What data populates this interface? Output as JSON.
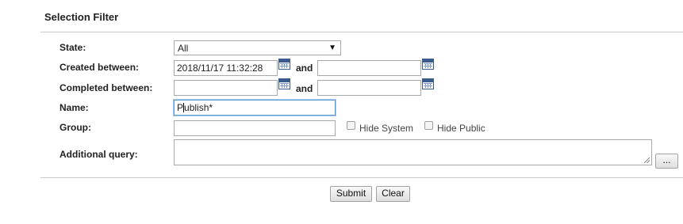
{
  "header": {
    "title": "Selection Filter"
  },
  "form": {
    "state": {
      "label": "State:",
      "value": "All"
    },
    "created": {
      "label": "Created between:",
      "from": "2018/11/17 11:32:28",
      "and": "and",
      "to": ""
    },
    "completed": {
      "label": "Completed between:",
      "from": "",
      "and": "and",
      "to": ""
    },
    "name": {
      "label": "Name:",
      "value_before_caret": "P",
      "value_after_caret": "ublish*"
    },
    "group": {
      "label": "Group:",
      "value": "",
      "hide_system": "Hide System",
      "hide_public": "Hide Public"
    },
    "additional": {
      "label": "Additional query:",
      "value": "",
      "ellipsis": "..."
    }
  },
  "actions": {
    "submit": "Submit",
    "clear": "Clear"
  },
  "icons": {
    "calendar": "calendar-icon",
    "dropdown": "chevron-down-icon",
    "resize": "resize-grip-icon"
  }
}
